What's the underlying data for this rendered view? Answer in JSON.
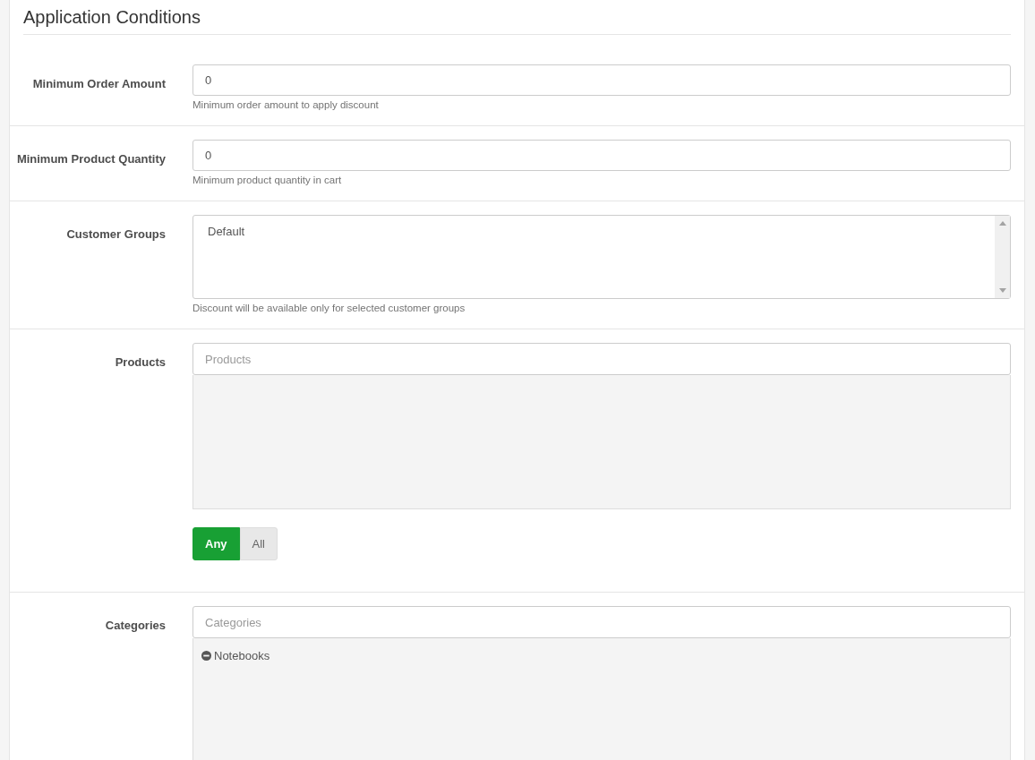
{
  "title": "Application Conditions",
  "rows": [
    {
      "kind": "text",
      "label": "Minimum Order Amount",
      "value": "0",
      "help": "Minimum order amount to apply discount"
    },
    {
      "kind": "text",
      "label": "Minimum Product Quantity",
      "value": "0",
      "help": "Minimum product quantity in cart"
    },
    {
      "kind": "listbox",
      "label": "Customer Groups",
      "options": [
        {
          "label": "Default",
          "selected": false
        }
      ],
      "help": "Discount will be available only for selected customer groups"
    },
    {
      "kind": "picker",
      "label": "Products",
      "placeholder": "Products",
      "items": [],
      "toggle": [
        {
          "label": "Any",
          "selected": true
        },
        {
          "label": "All",
          "selected": false
        }
      ]
    },
    {
      "kind": "picker",
      "label": "Categories",
      "placeholder": "Categories",
      "items": [
        {
          "label": "Notebooks"
        }
      ]
    }
  ]
}
